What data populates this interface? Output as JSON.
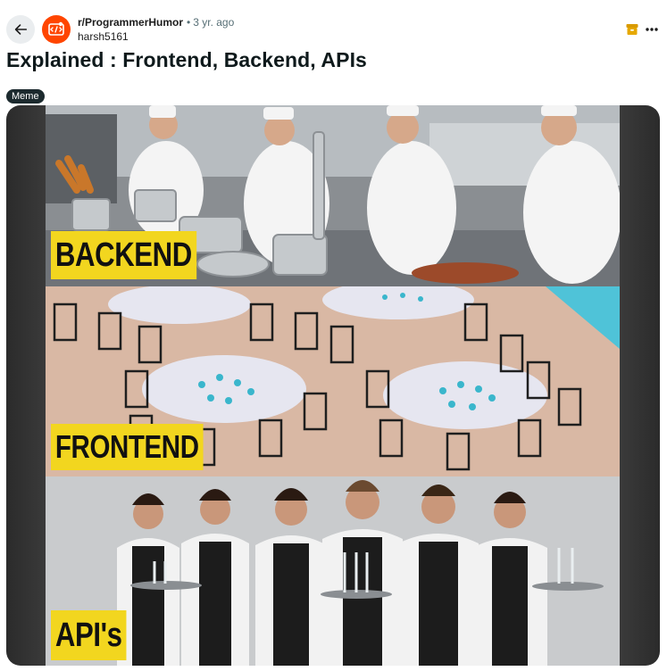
{
  "post": {
    "subreddit": "r/ProgrammerHumor",
    "separator": "•",
    "age": "3 yr. ago",
    "author": "harsh5161",
    "title": "Explained : Frontend, Backend, APIs",
    "flair": "Meme"
  },
  "meme": {
    "panels": [
      {
        "label": "BACKEND"
      },
      {
        "label": "FRONTEND"
      },
      {
        "label": "API's"
      }
    ]
  },
  "colors": {
    "avatar": "#ff4500",
    "flair_bg": "#1c2a2e",
    "label_yellow": "#f2d61f",
    "archive_icon": "#d99a00"
  },
  "icons": {
    "back": "arrow-left-icon",
    "avatar": "subreddit-avatar-icon",
    "archive": "archive-icon",
    "more": "more-horizontal-icon"
  }
}
